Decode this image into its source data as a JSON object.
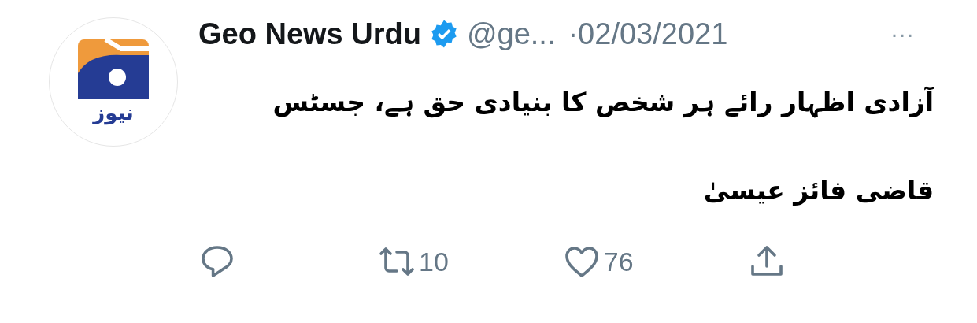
{
  "tweet": {
    "avatar_text": "نیوز",
    "name": "Geo News Urdu",
    "verified": true,
    "handle": "@ge...",
    "date": "·02/03/2021",
    "more": "···",
    "body": "آزادی اظہار رائے ہر شخص کا بنیادی حق ہے، جسٹس قاضی فائز عیسیٰ",
    "reply_button": {
      "kind": "reply"
    },
    "retweet_button": {
      "kind": "retweet",
      "count": "10"
    },
    "like_button": {
      "kind": "like",
      "count": "76"
    },
    "share_button": {
      "kind": "share"
    }
  }
}
